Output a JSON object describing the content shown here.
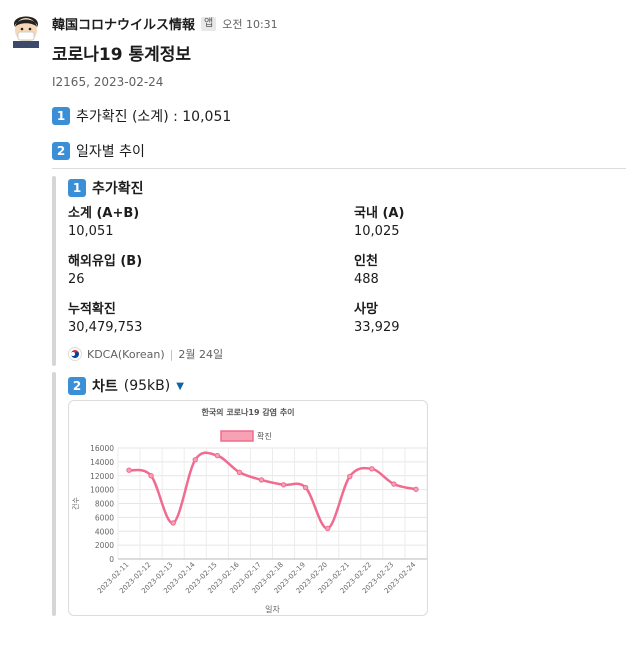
{
  "message": {
    "sender": "韓国コロナウイルス情報",
    "app_badge": "앱",
    "time": "오전 10:31",
    "title": "코로나19 통계정보",
    "subline": "I2165, 2023-02-24",
    "line1_num": "1",
    "line1_text": "추가확진 (소계) : 10,051",
    "line2_num": "2",
    "line2_text": "일자별 추이"
  },
  "attachment1": {
    "num": "1",
    "title": "추가확진",
    "fields": [
      {
        "label": "소계 (A+B)",
        "value": "10,051"
      },
      {
        "label": "국내 (A)",
        "value": "10,025"
      },
      {
        "label": "해외유입 (B)",
        "value": "26"
      },
      {
        "label": "인천",
        "value": "488"
      },
      {
        "label": "누적확진",
        "value": "30,479,753"
      },
      {
        "label": "사망",
        "value": "33,929"
      }
    ],
    "footer_source": "KDCA(Korean)",
    "footer_date": "2월 24일"
  },
  "attachment2": {
    "num": "2",
    "title": "차트",
    "size": "(95kB)"
  },
  "icons": {
    "avatar": "masked-person-avatar",
    "keycap": "keycap-number-icon",
    "flag": "korea-flag-icon",
    "caret": "caret-down-icon"
  },
  "colors": {
    "keycap": "#3a8fd6",
    "series_line": "#f06b8f",
    "series_fill": "#f7a1b5"
  },
  "chart_data": {
    "type": "line",
    "title": "한국의 코로나19 감염 추이",
    "xlabel": "일자",
    "ylabel": "건수",
    "ylim": [
      0,
      16000
    ],
    "yticks": [
      0,
      2000,
      4000,
      6000,
      8000,
      10000,
      12000,
      14000,
      16000
    ],
    "categories": [
      "2023-02-11",
      "2023-02-12",
      "2023-02-13",
      "2023-02-14",
      "2023-02-15",
      "2023-02-16",
      "2023-02-17",
      "2023-02-18",
      "2023-02-19",
      "2023-02-20",
      "2023-02-21",
      "2023-02-22",
      "2023-02-23",
      "2023-02-24"
    ],
    "series": [
      {
        "name": "확진",
        "values": [
          12800,
          12000,
          5200,
          14300,
          14900,
          12500,
          11400,
          10700,
          10300,
          4400,
          11900,
          13000,
          10800,
          10051
        ]
      }
    ],
    "legend": "top-center",
    "grid": true
  }
}
